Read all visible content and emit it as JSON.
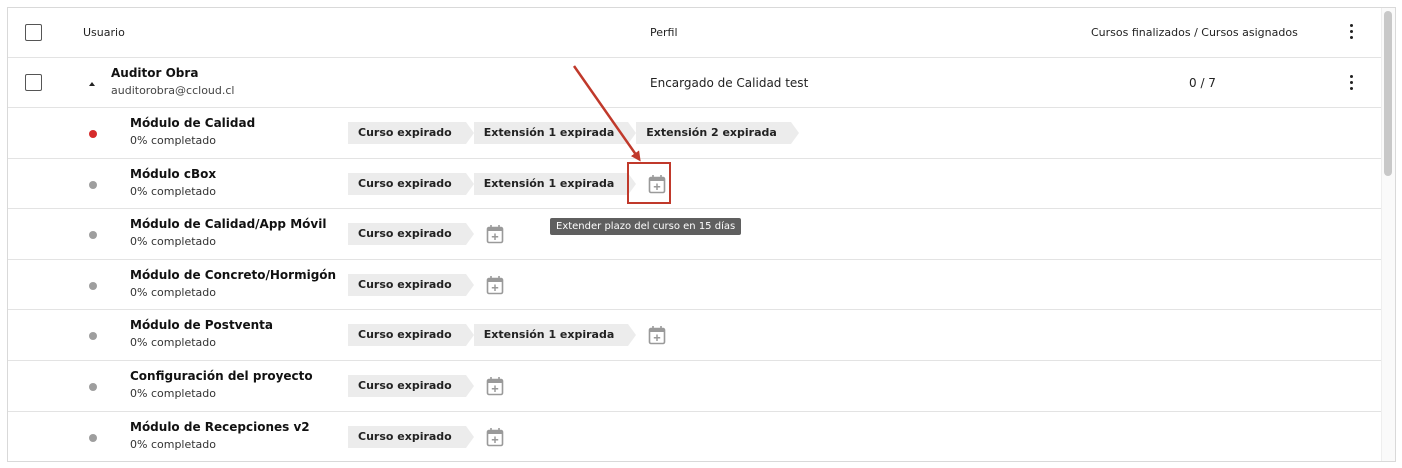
{
  "header": {
    "col_user": "Usuario",
    "col_profile": "Perfil",
    "col_courses": "Cursos finalizados / Cursos asignados"
  },
  "user": {
    "name": "Auditor Obra",
    "email": "auditorobra@ccloud.cl",
    "profile": "Encargado de Calidad test",
    "courses": "0 / 7"
  },
  "modules": [
    {
      "name": "Módulo de Calidad",
      "progress": "0% completado",
      "status_color": "#d62b2b",
      "chips": [
        "Curso expirado",
        "Extensión 1 expirada",
        "Extensión 2 expirada"
      ],
      "extend_icon": false
    },
    {
      "name": "Módulo cBox",
      "progress": "0% completado",
      "status_color": "#9e9e9e",
      "chips": [
        "Curso expirado",
        "Extensión 1 expirada"
      ],
      "extend_icon": true
    },
    {
      "name": "Módulo de Calidad/App Móvil",
      "progress": "0% completado",
      "status_color": "#9e9e9e",
      "chips": [
        "Curso expirado"
      ],
      "extend_icon": true
    },
    {
      "name": "Módulo de Concreto/Hormigón",
      "progress": "0% completado",
      "status_color": "#9e9e9e",
      "chips": [
        "Curso expirado"
      ],
      "extend_icon": true
    },
    {
      "name": "Módulo de Postventa",
      "progress": "0% completado",
      "status_color": "#9e9e9e",
      "chips": [
        "Curso expirado",
        "Extensión 1 expirada"
      ],
      "extend_icon": true
    },
    {
      "name": "Configuración del proyecto",
      "progress": "0% completado",
      "status_color": "#9e9e9e",
      "chips": [
        "Curso expirado"
      ],
      "extend_icon": true
    },
    {
      "name": "Módulo de Recepciones v2",
      "progress": "0% completado",
      "status_color": "#9e9e9e",
      "chips": [
        "Curso expirado"
      ],
      "extend_icon": true
    }
  ],
  "tooltip": "Extender plazo del curso en 15 días",
  "annotation_color": "#c0392b",
  "icons": {
    "extend": "calendar-plus-icon",
    "menu": "kebab-menu-icon",
    "expand": "caret-up-icon"
  }
}
